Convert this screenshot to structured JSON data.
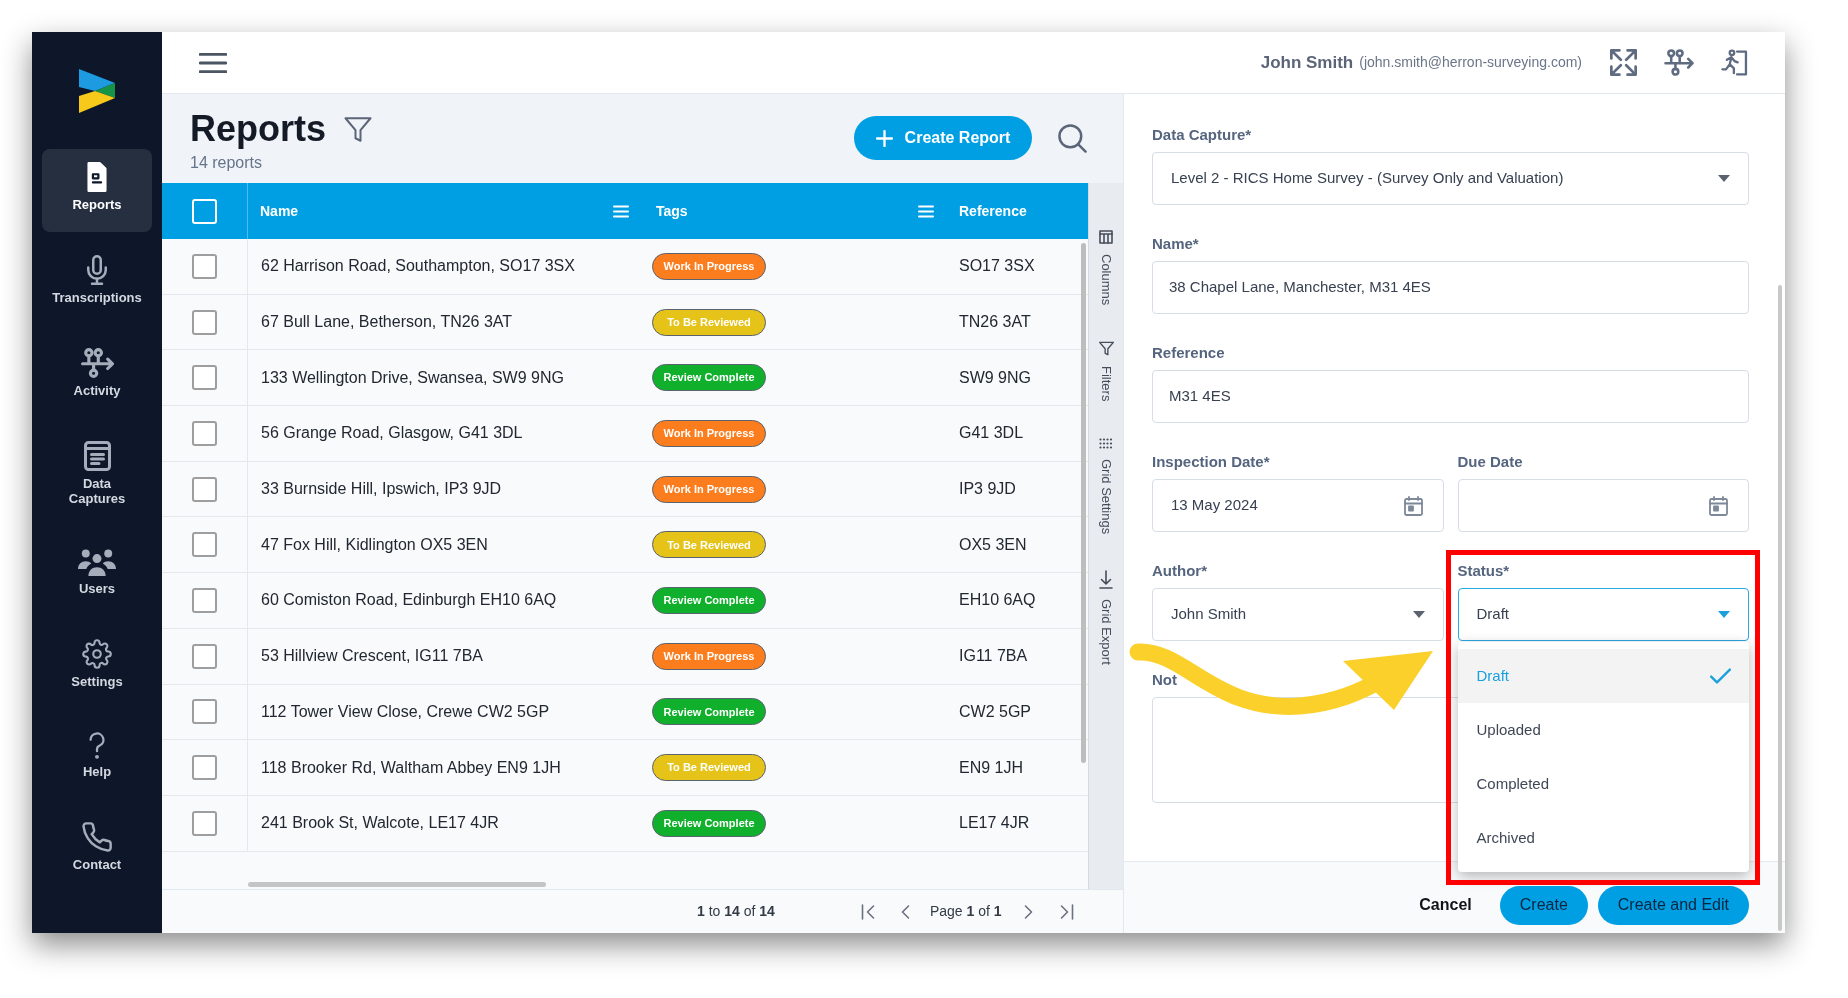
{
  "sidebar": {
    "items": [
      {
        "label": "Reports",
        "selected": true
      },
      {
        "label": "Transcriptions",
        "selected": false
      },
      {
        "label": "Activity",
        "selected": false
      },
      {
        "label": "Data Captures",
        "selected": false
      },
      {
        "label": "Users",
        "selected": false
      },
      {
        "label": "Settings",
        "selected": false
      },
      {
        "label": "Help",
        "selected": false
      },
      {
        "label": "Contact",
        "selected": false
      }
    ]
  },
  "header": {
    "user_name": "John Smith",
    "user_email": "(john.smith@herron-surveying.com)"
  },
  "reports": {
    "title": "Reports",
    "count": "14 reports",
    "create_button": "Create Report"
  },
  "table": {
    "select_all_checked": false,
    "columns": [
      {
        "label": "Name",
        "menu": true
      },
      {
        "label": "Tags",
        "menu": true
      },
      {
        "label": "Reference",
        "menu": false
      }
    ],
    "rows": [
      {
        "checked": false,
        "name": "62 Harrison Road, Southampton, SO17 3SX",
        "tag": {
          "label": "Work In Progress",
          "color": "#fb7d1d"
        },
        "reference": "SO17 3SX"
      },
      {
        "checked": false,
        "name": "67 Bull Lane, Betherson, TN26 3AT",
        "tag": {
          "label": "To Be Reviewed",
          "color": "#e5c318"
        },
        "reference": "TN26 3AT"
      },
      {
        "checked": false,
        "name": "133 Wellington Drive, Swansea, SW9 9NG",
        "tag": {
          "label": "Review Complete",
          "color": "#10b02c"
        },
        "reference": "SW9 9NG"
      },
      {
        "checked": false,
        "name": "56 Grange Road, Glasgow, G41 3DL",
        "tag": {
          "label": "Work In Progress",
          "color": "#fb7d1d"
        },
        "reference": "G41 3DL"
      },
      {
        "checked": false,
        "name": "33 Burnside Hill, Ipswich, IP3 9JD",
        "tag": {
          "label": "Work In Progress",
          "color": "#fb7d1d"
        },
        "reference": "IP3 9JD"
      },
      {
        "checked": false,
        "name": "47 Fox Hill, Kidlington OX5 3EN",
        "tag": {
          "label": "To Be Reviewed",
          "color": "#e5c318"
        },
        "reference": "OX5 3EN"
      },
      {
        "checked": false,
        "name": "60 Comiston Road, Edinburgh EH10 6AQ",
        "tag": {
          "label": "Review Complete",
          "color": "#10b02c"
        },
        "reference": "EH10 6AQ"
      },
      {
        "checked": false,
        "name": "53 Hillview Crescent, IG11 7BA",
        "tag": {
          "label": "Work In Progress",
          "color": "#fb7d1d"
        },
        "reference": "IG11 7BA"
      },
      {
        "checked": false,
        "name": "112 Tower View Close, Crewe CW2 5GP",
        "tag": {
          "label": "Review Complete",
          "color": "#10b02c"
        },
        "reference": "CW2 5GP"
      },
      {
        "checked": false,
        "name": "118 Brooker Rd, Waltham Abbey EN9 1JH",
        "tag": {
          "label": "To Be Reviewed",
          "color": "#e5c318"
        },
        "reference": "EN9 1JH"
      },
      {
        "checked": false,
        "name": "241 Brook St, Walcote, LE17 4JR",
        "tag": {
          "label": "Review Complete",
          "color": "#10b02c"
        },
        "reference": "LE17 4JR"
      }
    ]
  },
  "pagination": {
    "summary": "**1** to **14** of **14**",
    "page": "Page **1** of **1**"
  },
  "side_tools": [
    "Columns",
    "Filters",
    "Grid Settings",
    "Grid Export"
  ],
  "form": {
    "rows": [
      [
        {
          "label": "Data Capture*",
          "kind": "select",
          "value": "Level 2 - RICS Home Survey - (Survey Only and Valuation)",
          "expanded": false
        }
      ],
      [
        {
          "label": "Name*",
          "kind": "text",
          "value": "38 Chapel Lane, Manchester, M31 4ES"
        }
      ],
      [
        {
          "label": "Reference",
          "kind": "text",
          "value": "M31 4ES"
        }
      ],
      [
        {
          "label": "Inspection Date*",
          "kind": "date",
          "value": "13 May 2024"
        },
        {
          "label": "Due Date",
          "kind": "date"
        }
      ],
      [
        {
          "label": "Author*",
          "kind": "select",
          "value": "John Smith",
          "expanded": false
        },
        {
          "label": "Status*",
          "kind": "select",
          "value": "Draft",
          "expanded": true
        }
      ],
      [
        {
          "label": "Not",
          "kind": "textarea"
        }
      ]
    ],
    "open_dropdown": {
      "options": [
        {
          "label": "Draft",
          "selected": true
        },
        {
          "label": "Uploaded",
          "selected": false
        },
        {
          "label": "Completed",
          "selected": false
        },
        {
          "label": "Archived",
          "selected": false
        }
      ]
    },
    "buttons": [
      {
        "label": "Cancel",
        "kind": "text"
      },
      {
        "label": "Create",
        "kind": "primary"
      },
      {
        "label": "Create and Edit",
        "kind": "primary"
      }
    ]
  }
}
